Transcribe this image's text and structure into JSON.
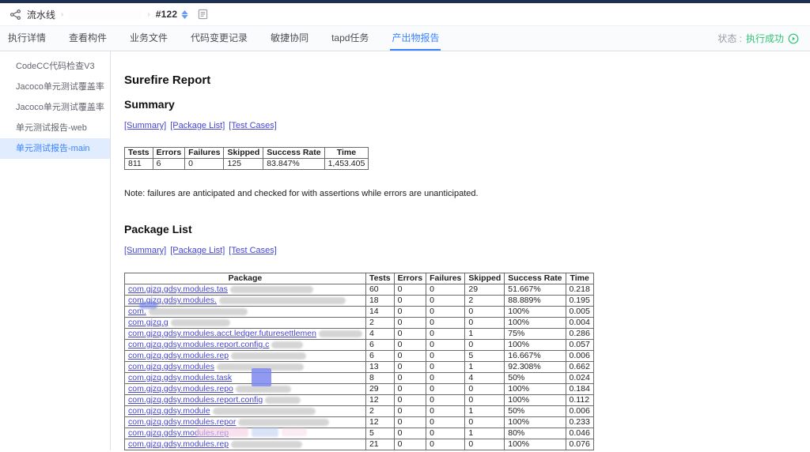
{
  "header": {
    "breadcrumb_root": "流水线",
    "build_number": "#122"
  },
  "tabs": [
    {
      "label": "执行详情",
      "active": false
    },
    {
      "label": "查看构件",
      "active": false
    },
    {
      "label": "业务文件",
      "active": false
    },
    {
      "label": "代码变更记录",
      "active": false
    },
    {
      "label": "敏捷协同",
      "active": false
    },
    {
      "label": "tapd任务",
      "active": false
    },
    {
      "label": "产出物报告",
      "active": true
    }
  ],
  "status": {
    "label": "状态 :",
    "value": "执行成功"
  },
  "sidebar": {
    "items": [
      {
        "label": "CodeCC代码检查V3",
        "active": false
      },
      {
        "label": "Jacoco单元测试覆盖率",
        "active": false
      },
      {
        "label": "Jacoco单元测试覆盖率",
        "active": false
      },
      {
        "label": "单元测试报告-web",
        "active": false
      },
      {
        "label": "单元测试报告-main",
        "active": true
      }
    ]
  },
  "report": {
    "title": "Surefire Report",
    "summary_heading": "Summary",
    "package_heading": "Package List",
    "nav_links": [
      "[Summary]",
      "[Package List]",
      "[Test Cases]"
    ],
    "note": "Note: failures are anticipated and checked for with assertions while errors are unanticipated.",
    "summary_table": {
      "headers": [
        "Tests",
        "Errors",
        "Failures",
        "Skipped",
        "Success Rate",
        "Time"
      ],
      "row": [
        "811",
        "6",
        "0",
        "125",
        "83.847%",
        "1,453.405"
      ]
    },
    "package_table": {
      "headers": [
        "Package",
        "Tests",
        "Errors",
        "Failures",
        "Skipped",
        "Success Rate",
        "Time"
      ],
      "rows": [
        {
          "pkg": "com.gjzq.gdsy.modules.tas",
          "blur": 105,
          "tests": "60",
          "errors": "0",
          "failures": "0",
          "skipped": "29",
          "rate": "51.667%",
          "time": "0.218"
        },
        {
          "pkg": "com.gjzq.gdsy.modules.",
          "blur": 160,
          "tests": "18",
          "errors": "0",
          "failures": "0",
          "skipped": "2",
          "rate": "88.889%",
          "time": "0.195"
        },
        {
          "pkg": "com.",
          "blur": 125,
          "tests": "14",
          "errors": "0",
          "failures": "0",
          "skipped": "0",
          "rate": "100%",
          "time": "0.005"
        },
        {
          "pkg": "com.gjzq.g",
          "blur": 75,
          "tests": "2",
          "errors": "0",
          "failures": "0",
          "skipped": "0",
          "rate": "100%",
          "time": "0.004"
        },
        {
          "pkg": "com.gjzq.gdsy.modules.acct.ledger.futuresettlemen",
          "blur": 55,
          "tests": "4",
          "errors": "0",
          "failures": "0",
          "skipped": "1",
          "rate": "75%",
          "time": "0.286"
        },
        {
          "pkg": "com.gjzq.gdsy.modules.report.config.c",
          "blur": 40,
          "tests": "6",
          "errors": "0",
          "failures": "0",
          "skipped": "0",
          "rate": "100%",
          "time": "0.057"
        },
        {
          "pkg": "com.gjzq.gdsy.modules.rep",
          "blur": 95,
          "tests": "6",
          "errors": "0",
          "failures": "0",
          "skipped": "5",
          "rate": "16.667%",
          "time": "0.006"
        },
        {
          "pkg": "com.gjzq.gdsy.modules",
          "blur": 110,
          "tests": "13",
          "errors": "0",
          "failures": "0",
          "skipped": "1",
          "rate": "92.308%",
          "time": "0.662"
        },
        {
          "pkg": "com.gjzq.gdsy.modules.task",
          "blur": 0,
          "tests": "8",
          "errors": "0",
          "failures": "0",
          "skipped": "4",
          "rate": "50%",
          "time": "0.024"
        },
        {
          "pkg": "com.gjzq.gdsy.modules.repo",
          "blur": 70,
          "tests": "29",
          "errors": "0",
          "failures": "0",
          "skipped": "0",
          "rate": "100%",
          "time": "0.184"
        },
        {
          "pkg": "com.gjzq.gdsy.modules.report.config",
          "blur": 45,
          "tests": "12",
          "errors": "0",
          "failures": "0",
          "skipped": "0",
          "rate": "100%",
          "time": "0.112"
        },
        {
          "pkg": "com.gjzq.gdsy.module",
          "blur": 130,
          "tests": "2",
          "errors": "0",
          "failures": "0",
          "skipped": "1",
          "rate": "50%",
          "time": "0.006"
        },
        {
          "pkg": "com.gjzq.gdsy.modules.repor",
          "blur": 115,
          "tests": "12",
          "errors": "0",
          "failures": "0",
          "skipped": "0",
          "rate": "100%",
          "time": "0.233"
        },
        {
          "pkg": "com.gjzq.gdsy.modules.rep",
          "blur": 0,
          "tests": "5",
          "errors": "0",
          "failures": "0",
          "skipped": "1",
          "rate": "80%",
          "time": "0.046"
        },
        {
          "pkg": "com.gjzq.gdsy.modules.rep",
          "blur": 90,
          "tests": "21",
          "errors": "0",
          "failures": "0",
          "skipped": "0",
          "rate": "100%",
          "time": "0.076"
        }
      ]
    }
  },
  "colors": {
    "topbar": "#1e3150",
    "accent_blue": "#3a84ff",
    "success_green": "#30c473",
    "link_blue": "#4646cf",
    "sidebar_active_bg": "#e1ecff"
  }
}
